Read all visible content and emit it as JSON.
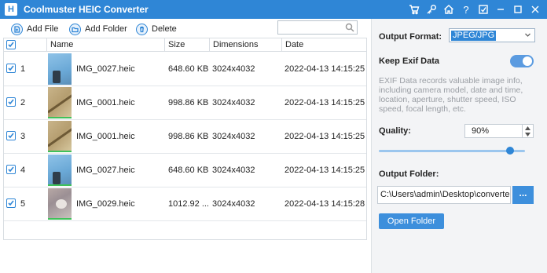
{
  "app": {
    "title": "Coolmuster HEIC Converter",
    "logo_letter": "H"
  },
  "titlebar_icons": [
    "cart-icon",
    "key-icon",
    "home-icon",
    "help-icon",
    "feedback-icon",
    "minimize-icon",
    "maximize-icon",
    "close-icon"
  ],
  "titlebar_glyphs": {
    "help": "?"
  },
  "toolbar": {
    "add_file": "Add File",
    "add_folder": "Add Folder",
    "delete": "Delete",
    "search_value": ""
  },
  "table": {
    "columns": [
      "Name",
      "Size",
      "Dimensions",
      "Date"
    ],
    "rows": [
      {
        "index": "1",
        "name": "IMG_0027.heic",
        "size": "648.60 KB",
        "dimensions": "3024x4032",
        "date": "2022-04-13 14:15:25",
        "checked": true
      },
      {
        "index": "2",
        "name": "IMG_0001.heic",
        "size": "998.86 KB",
        "dimensions": "3024x4032",
        "date": "2022-04-13 14:15:25",
        "checked": true
      },
      {
        "index": "3",
        "name": "IMG_0001.heic",
        "size": "998.86 KB",
        "dimensions": "3024x4032",
        "date": "2022-04-13 14:15:25",
        "checked": true
      },
      {
        "index": "4",
        "name": "IMG_0027.heic",
        "size": "648.60 KB",
        "dimensions": "3024x4032",
        "date": "2022-04-13 14:15:25",
        "checked": true
      },
      {
        "index": "5",
        "name": "IMG_0029.heic",
        "size": "1012.92 ...",
        "dimensions": "3024x4032",
        "date": "2022-04-13 14:15:28",
        "checked": true
      }
    ]
  },
  "settings": {
    "output_format_label": "Output Format:",
    "output_format_value": "JPEG/JPG",
    "keep_exif_label": "Keep Exif Data",
    "keep_exif_on": true,
    "exif_description": "EXIF Data records valuable image info, including camera model, date and time, location, aperture, shutter speed, ISO speed, focal length, etc.",
    "quality_label": "Quality:",
    "quality_value": "90%",
    "quality_fraction": 0.9,
    "output_folder_label": "Output Folder:",
    "output_folder_path": "C:\\Users\\admin\\Desktop\\converted-",
    "browse_label": "...",
    "open_folder_label": "Open Folder"
  },
  "colors": {
    "accent": "#2f86d6",
    "panel_bg": "#f3f4f6"
  }
}
